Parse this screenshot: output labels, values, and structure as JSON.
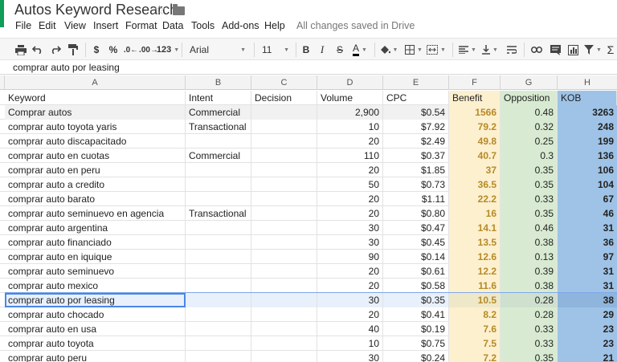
{
  "app": {
    "title": "Autos Keyword Research",
    "save_status": "All changes saved in Drive"
  },
  "menu": [
    "File",
    "Edit",
    "View",
    "Insert",
    "Format",
    "Data",
    "Tools",
    "Add-ons",
    "Help"
  ],
  "toolbar": {
    "currency": "$",
    "percent": "%",
    "dec_decrease": ".0←",
    "dec_increase": ".00→",
    "more_formats": "123",
    "font": "Arial",
    "font_size": "11",
    "bold": "B",
    "italic": "I",
    "strike": "S",
    "text_color": "A"
  },
  "formula_bar": {
    "content": "comprar auto por leasing"
  },
  "columns": [
    "A",
    "B",
    "C",
    "D",
    "E",
    "F",
    "G",
    "H"
  ],
  "header_row": [
    "Keyword",
    "Intent",
    "Decision",
    "Volume",
    "CPC",
    "Benefit",
    "Opposition",
    "KOB"
  ],
  "rows": [
    [
      "Comprar autos",
      "Commercial",
      "",
      "2,900",
      "$0.54",
      "1566",
      "0.48",
      "3263"
    ],
    [
      "comprar auto toyota yaris",
      "Transactional",
      "",
      "10",
      "$7.92",
      "79.2",
      "0.32",
      "248"
    ],
    [
      "comprar auto discapacitado",
      "",
      "",
      "20",
      "$2.49",
      "49.8",
      "0.25",
      "199"
    ],
    [
      "comprar auto en cuotas",
      "Commercial",
      "",
      "110",
      "$0.37",
      "40.7",
      "0.3",
      "136"
    ],
    [
      "comprar auto en peru",
      "",
      "",
      "20",
      "$1.85",
      "37",
      "0.35",
      "106"
    ],
    [
      "comprar auto a credito",
      "",
      "",
      "50",
      "$0.73",
      "36.5",
      "0.35",
      "104"
    ],
    [
      "comprar auto barato",
      "",
      "",
      "20",
      "$1.11",
      "22.2",
      "0.33",
      "67"
    ],
    [
      "comprar auto seminuevo en agencia",
      "Transactional",
      "",
      "20",
      "$0.80",
      "16",
      "0.35",
      "46"
    ],
    [
      "comprar auto argentina",
      "",
      "",
      "30",
      "$0.47",
      "14.1",
      "0.46",
      "31"
    ],
    [
      "comprar auto financiado",
      "",
      "",
      "30",
      "$0.45",
      "13.5",
      "0.38",
      "36"
    ],
    [
      "comprar auto en iquique",
      "",
      "",
      "90",
      "$0.14",
      "12.6",
      "0.13",
      "97"
    ],
    [
      "comprar auto seminuevo",
      "",
      "",
      "20",
      "$0.61",
      "12.2",
      "0.39",
      "31"
    ],
    [
      "comprar auto mexico",
      "",
      "",
      "20",
      "$0.58",
      "11.6",
      "0.38",
      "31"
    ],
    [
      "comprar auto por leasing",
      "",
      "",
      "30",
      "$0.35",
      "10.5",
      "0.28",
      "38"
    ],
    [
      "comprar auto chocado",
      "",
      "",
      "20",
      "$0.41",
      "8.2",
      "0.28",
      "29"
    ],
    [
      "comprar auto en usa",
      "",
      "",
      "40",
      "$0.19",
      "7.6",
      "0.33",
      "23"
    ],
    [
      "comprar auto toyota",
      "",
      "",
      "10",
      "$0.75",
      "7.5",
      "0.33",
      "23"
    ],
    [
      "comprar auto peru",
      "",
      "",
      "30",
      "$0.24",
      "7.2",
      "0.35",
      "21"
    ]
  ],
  "selected_row": 13,
  "colors": {
    "accent_green": "#0f9d58",
    "benefit_fill": "#fdf0cf",
    "opposition_fill": "#d8ebd2",
    "kob_fill": "#9fc3e6",
    "selection": "#4a86e8"
  }
}
